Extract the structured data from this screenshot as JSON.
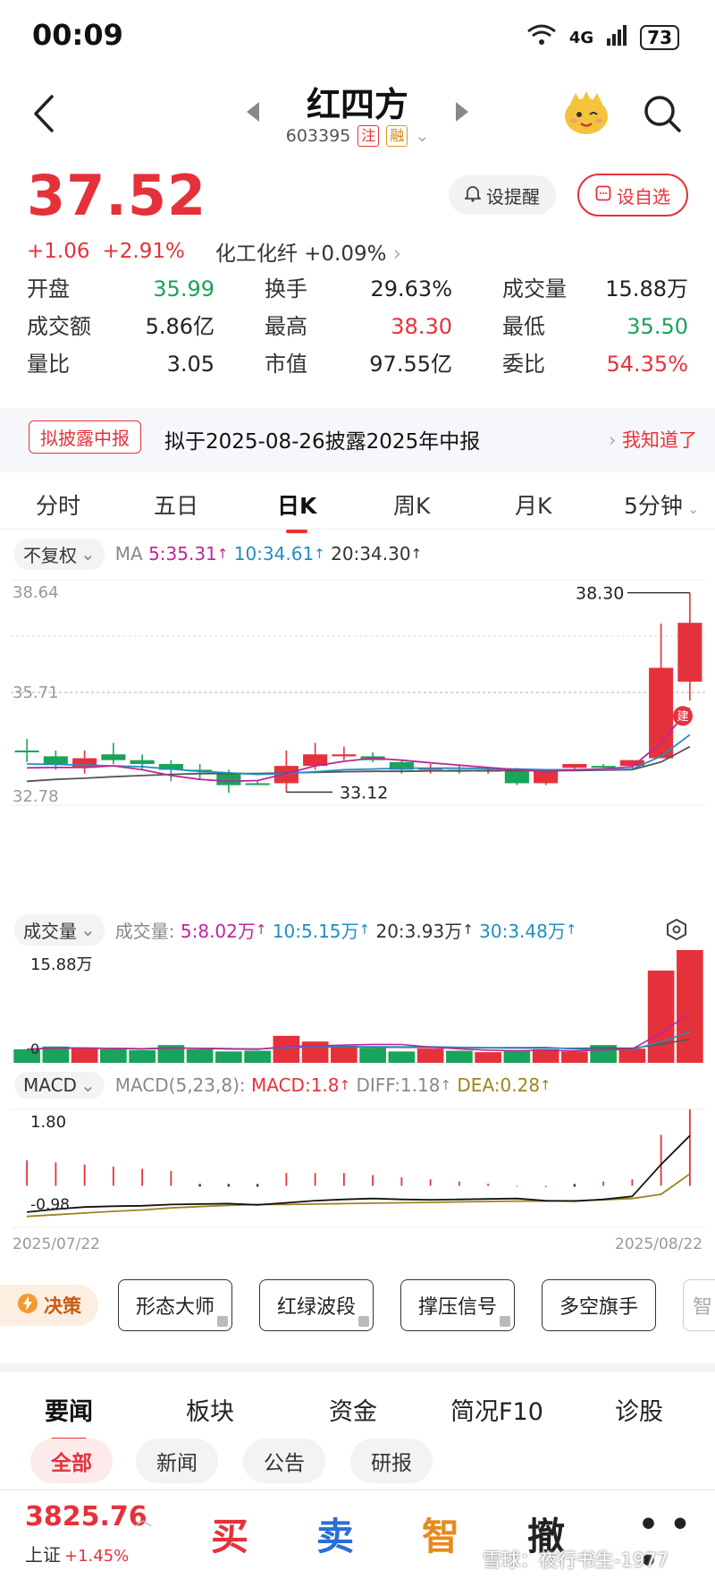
{
  "status": {
    "time": "00:09",
    "battery": "73",
    "signal": "4G"
  },
  "nav": {
    "title": "红四方",
    "code": "603395",
    "tag1": "注",
    "tag2": "融"
  },
  "quote": {
    "price": "37.52",
    "change": "+1.06",
    "change_pct": "+2.91%",
    "sector": "化工化纤",
    "sector_pct": "+0.09%",
    "remind_label": "设提醒",
    "fav_label": "设自选"
  },
  "stats": [
    {
      "k": "开盘",
      "v": "35.99",
      "c": "green"
    },
    {
      "k": "换手",
      "v": "29.63%",
      "c": "dark"
    },
    {
      "k": "成交量",
      "v": "15.88万",
      "c": "dark"
    },
    {
      "k": "成交额",
      "v": "5.86亿",
      "c": "dark"
    },
    {
      "k": "最高",
      "v": "38.30",
      "c": "red"
    },
    {
      "k": "最低",
      "v": "35.50",
      "c": "green"
    },
    {
      "k": "量比",
      "v": "3.05",
      "c": "dark"
    },
    {
      "k": "市值",
      "v": "97.55亿",
      "c": "dark"
    },
    {
      "k": "委比",
      "v": "54.35%",
      "c": "red"
    }
  ],
  "banner": {
    "tag": "拟披露中报",
    "text": "拟于2025-08-26披露2025年中报",
    "link": "我知道了"
  },
  "tabs": [
    "分时",
    "五日",
    "日K",
    "周K",
    "月K",
    "5分钟"
  ],
  "ma_row": {
    "adjust": "不复权",
    "label": "MA",
    "ma5": "5:35.31",
    "ma10": "10:34.61",
    "ma20": "20:34.30"
  },
  "vol_row": {
    "label": "成交量",
    "prefix": "成交量:",
    "v5": "5:8.02万",
    "v10": "10:5.15万",
    "v20": "20:3.93万",
    "v30": "30:3.48万"
  },
  "macd_row": {
    "label": "MACD",
    "params": "MACD(5,23,8):",
    "macd": "MACD:1.8",
    "diff": "DIFF:1.18",
    "dea": "DEA:0.28"
  },
  "chart_labels": {
    "price_top": "38.64",
    "price_mid": "35.71",
    "price_bottom": "32.78",
    "high_mark": "38.30",
    "low_mark": "33.12",
    "badge": "建",
    "vol_top": "15.88万",
    "vol_zero": "0",
    "macd_top": "1.80",
    "macd_bottom": "-0.98",
    "date_start": "2025/07/22",
    "date_end": "2025/08/22"
  },
  "chart_data": {
    "type": "candlestick",
    "y_axis_price": [
      32.78,
      38.64
    ],
    "candles": [
      {
        "o": 34.2,
        "c": 34.2,
        "h": 34.5,
        "l": 33.9,
        "up": false
      },
      {
        "o": 34.05,
        "c": 33.85,
        "h": 34.2,
        "l": 33.7,
        "up": false
      },
      {
        "o": 33.75,
        "c": 34.0,
        "h": 34.2,
        "l": 33.6,
        "up": true
      },
      {
        "o": 34.1,
        "c": 33.95,
        "h": 34.4,
        "l": 33.85,
        "up": false
      },
      {
        "o": 33.95,
        "c": 33.85,
        "h": 34.1,
        "l": 33.7,
        "up": false
      },
      {
        "o": 33.85,
        "c": 33.7,
        "h": 33.95,
        "l": 33.4,
        "up": false
      },
      {
        "o": 33.7,
        "c": 33.7,
        "h": 33.85,
        "l": 33.45,
        "up": false
      },
      {
        "o": 33.6,
        "c": 33.3,
        "h": 33.7,
        "l": 33.1,
        "up": false
      },
      {
        "o": 33.35,
        "c": 33.35,
        "h": 33.4,
        "l": 33.3,
        "up": false
      },
      {
        "o": 33.35,
        "c": 33.8,
        "h": 34.2,
        "l": 33.12,
        "up": true
      },
      {
        "o": 33.8,
        "c": 34.1,
        "h": 34.4,
        "l": 33.7,
        "up": true
      },
      {
        "o": 34.1,
        "c": 34.05,
        "h": 34.3,
        "l": 33.95,
        "up": true
      },
      {
        "o": 34.05,
        "c": 33.95,
        "h": 34.15,
        "l": 33.9,
        "up": false
      },
      {
        "o": 33.9,
        "c": 33.7,
        "h": 33.95,
        "l": 33.6,
        "up": false
      },
      {
        "o": 33.7,
        "c": 33.75,
        "h": 33.85,
        "l": 33.6,
        "up": true
      },
      {
        "o": 33.7,
        "c": 33.65,
        "h": 33.8,
        "l": 33.6,
        "up": false
      },
      {
        "o": 33.65,
        "c": 33.7,
        "h": 33.75,
        "l": 33.6,
        "up": true
      },
      {
        "o": 33.7,
        "c": 33.35,
        "h": 33.75,
        "l": 33.3,
        "up": false
      },
      {
        "o": 33.65,
        "c": 33.35,
        "h": 33.65,
        "l": 33.3,
        "up": true
      },
      {
        "o": 33.75,
        "c": 33.85,
        "h": 33.85,
        "l": 33.7,
        "up": true
      },
      {
        "o": 33.8,
        "c": 33.75,
        "h": 33.85,
        "l": 33.7,
        "up": false
      },
      {
        "o": 33.8,
        "c": 33.95,
        "h": 33.95,
        "l": 33.7,
        "up": true
      },
      {
        "o": 34.0,
        "c": 36.35,
        "h": 37.5,
        "l": 34.0,
        "up": true
      },
      {
        "o": 35.99,
        "c": 37.52,
        "h": 38.3,
        "l": 35.5,
        "up": true
      }
    ],
    "ma5": [
      33.75,
      33.76,
      33.76,
      33.8,
      33.7,
      33.55,
      33.45,
      33.4,
      33.42,
      33.6,
      33.8,
      33.92,
      34.0,
      33.95,
      33.88,
      33.82,
      33.76,
      33.7,
      33.65,
      33.7,
      33.72,
      33.78,
      34.4,
      35.31
    ],
    "ma10": [
      33.85,
      33.84,
      33.82,
      33.8,
      33.78,
      33.72,
      33.66,
      33.62,
      33.58,
      33.6,
      33.65,
      33.7,
      33.72,
      33.74,
      33.74,
      33.74,
      33.73,
      33.72,
      33.7,
      33.7,
      33.7,
      33.72,
      34.05,
      34.61
    ],
    "ma20": [
      33.4,
      33.45,
      33.48,
      33.52,
      33.55,
      33.58,
      33.6,
      33.6,
      33.6,
      33.62,
      33.63,
      33.65,
      33.66,
      33.66,
      33.67,
      33.67,
      33.68,
      33.68,
      33.68,
      33.68,
      33.69,
      33.7,
      33.9,
      34.3
    ],
    "volume_max": 15.88,
    "volume": [
      1.9,
      2.3,
      2.0,
      1.9,
      1.8,
      2.5,
      1.9,
      1.6,
      1.7,
      3.8,
      3.0,
      2.4,
      2.1,
      1.6,
      2.0,
      1.7,
      1.5,
      1.7,
      1.9,
      1.6,
      2.5,
      2.0,
      13.0,
      15.88
    ],
    "macd_range": [
      -0.98,
      1.8
    ],
    "macd": [
      0.6,
      0.55,
      0.5,
      0.45,
      0.4,
      0.35,
      0.01,
      0.01,
      0.01,
      0.3,
      0.3,
      0.3,
      0.25,
      0.2,
      0.15,
      0.1,
      0.05,
      -0.02,
      -0.03,
      0.01,
      0.1,
      0.15,
      1.2,
      1.8
    ],
    "diff": [
      -0.62,
      -0.55,
      -0.5,
      -0.48,
      -0.47,
      -0.44,
      -0.43,
      -0.42,
      -0.45,
      -0.4,
      -0.35,
      -0.32,
      -0.3,
      -0.32,
      -0.33,
      -0.32,
      -0.31,
      -0.3,
      -0.35,
      -0.36,
      -0.32,
      -0.25,
      0.5,
      1.18
    ],
    "dea": [
      -0.72,
      -0.68,
      -0.64,
      -0.6,
      -0.57,
      -0.52,
      -0.49,
      -0.46,
      -0.44,
      -0.44,
      -0.43,
      -0.42,
      -0.41,
      -0.4,
      -0.39,
      -0.38,
      -0.37,
      -0.36,
      -0.36,
      -0.35,
      -0.33,
      -0.3,
      -0.2,
      0.28
    ]
  },
  "decision": {
    "label": "决策",
    "chips": [
      "形态大师",
      "红绿波段",
      "撑压信号",
      "多空旗手",
      "智"
    ]
  },
  "section_tabs": [
    "要闻",
    "板块",
    "资金",
    "简况F10",
    "诊股"
  ],
  "filters": [
    "全部",
    "新闻",
    "公告",
    "研报"
  ],
  "bottom": {
    "index_value": "3825.76",
    "index_name": "上证",
    "index_change": "+1.45%",
    "buy": "买",
    "sell": "卖",
    "smart": "智",
    "cancel": "撤",
    "more": "• • •",
    "watermark": "雪球：夜行书生-1977"
  },
  "colors": {
    "up": "#e5323a",
    "down": "#1aa35a",
    "ma5": "#c0259a",
    "ma10": "#1e8fc0",
    "ma20": "#555555",
    "dea": "#9c8420"
  }
}
